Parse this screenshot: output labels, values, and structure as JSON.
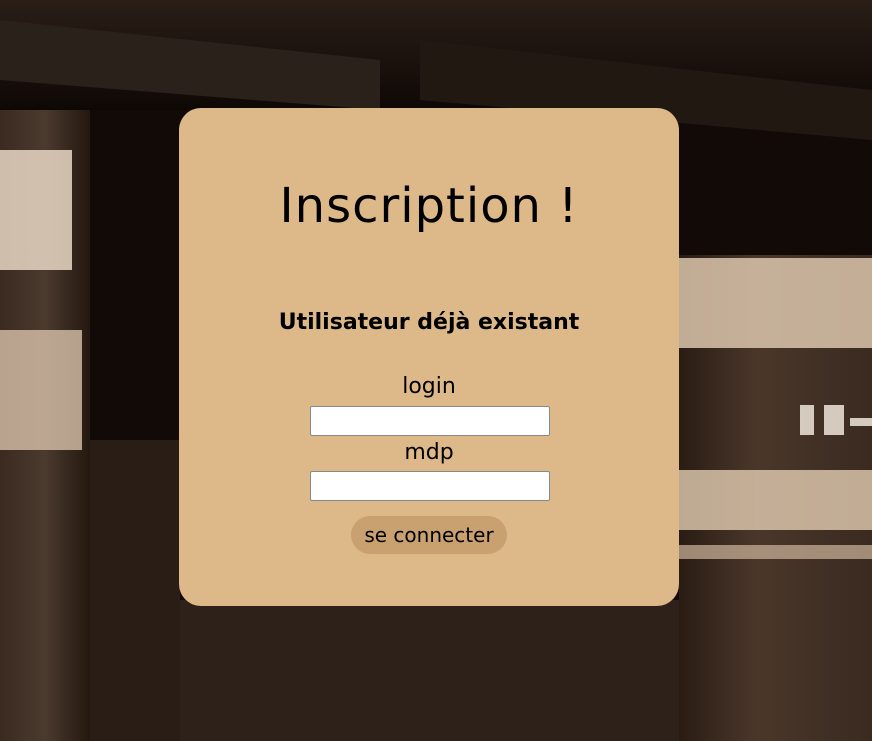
{
  "page": {
    "title": "Inscription !",
    "error_message": "Utilisateur déjà existant"
  },
  "form": {
    "login_label": "login",
    "login_value": "",
    "password_label": "mdp",
    "password_value": "",
    "submit_label": "se connecter"
  },
  "colors": {
    "card_background": "#ddb98a",
    "button_background": "#c9a070",
    "page_background": "#140c08"
  }
}
